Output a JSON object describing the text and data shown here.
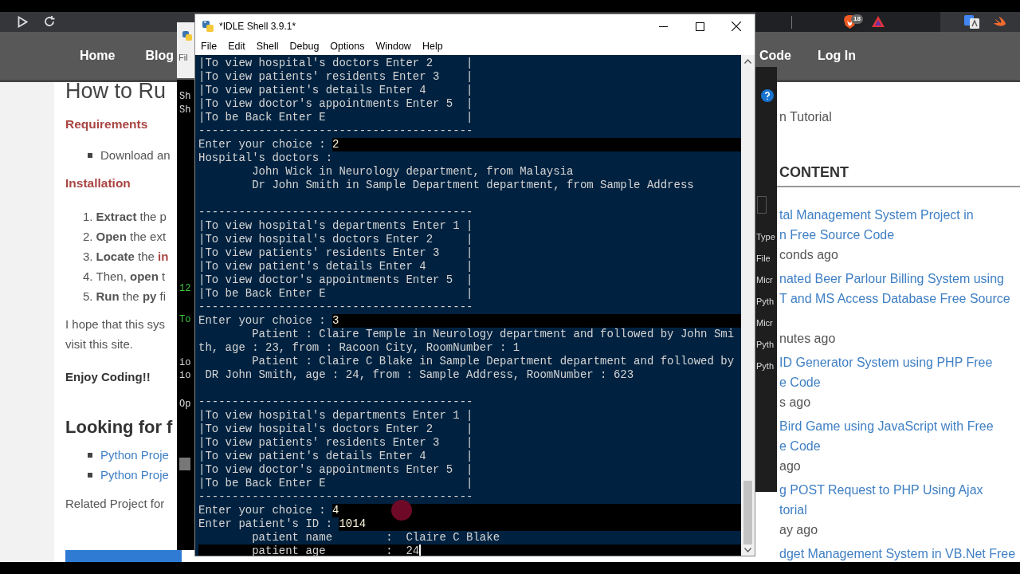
{
  "browser": {
    "extension_badge": "18",
    "nav_left": [
      "Home",
      "Blog"
    ],
    "nav_right": [
      "Code",
      "Log In"
    ]
  },
  "article": {
    "title": "How to Ru",
    "requirements_heading": "Requirements",
    "requirements": [
      "Download an"
    ],
    "installation_heading": "Installation",
    "steps": [
      {
        "number": "1.",
        "text": "**Extract** the p"
      },
      {
        "number": "2.",
        "text": "**Open** the ext"
      },
      {
        "number": "3.",
        "text": "**Locate** the ",
        "accent": "in"
      },
      {
        "number": "4.",
        "text": "Then, **open** t"
      },
      {
        "number": "5.",
        "text": "**Run** the **py** fi"
      }
    ],
    "paragraph": [
      "I hope that this sys",
      "visit this site."
    ],
    "closing": "Enjoy Coding!!",
    "more_heading": "Looking for f",
    "links": [
      "Python Proje",
      "Python Proje"
    ],
    "related": "Related Project for"
  },
  "sidebar": {
    "intro": "n Tutorial",
    "heading": "CONTENT",
    "posts": [
      {
        "title": [
          "tal Management System Project in",
          "n Free Source Code"
        ],
        "time": "conds ago"
      },
      {
        "title": [
          "nated Beer Parlour Billing System using",
          "T and MS Access Database Free Source"
        ],
        "covered_line": true,
        "time": "nutes ago"
      },
      {
        "title": [
          "ID Generator System using PHP Free",
          "e Code"
        ],
        "time": "s ago"
      },
      {
        "title": [
          "Bird Game using JavaScript with Free",
          "e Code"
        ],
        "time": "ago"
      },
      {
        "title": [
          "g POST Request to PHP Using Ajax",
          "torial"
        ],
        "time": "ay ago"
      },
      {
        "title": [
          "dget Management System in VB.Net Free"
        ]
      }
    ]
  },
  "back_window": {
    "left_lines": [
      {
        "text": "Sh",
        "kind": "plain"
      },
      {
        "text": "Sh",
        "kind": "plain"
      },
      {
        "text": "12",
        "kind": "green"
      },
      {
        "text": "To",
        "kind": "green"
      },
      {
        "text": "io",
        "kind": "plain"
      },
      {
        "text": "io",
        "kind": "plain"
      },
      {
        "text": "Op",
        "kind": "plain"
      }
    ],
    "right_items": [
      "Type",
      "File",
      "Micr",
      "Pyth",
      "Micr",
      "Pyth",
      "Pyth"
    ]
  },
  "other_idle": {
    "menu_fragment": "Fil"
  },
  "idle": {
    "title": "*IDLE Shell 3.9.1*",
    "menu": [
      "File",
      "Edit",
      "Shell",
      "Debug",
      "Options",
      "Window",
      "Help"
    ],
    "lines": [
      {
        "kind": "text",
        "text": "|To view hospital's doctors Enter 2     |"
      },
      {
        "kind": "text",
        "text": "|To view patients' residents Enter 3    |"
      },
      {
        "kind": "text",
        "text": "|To view patient's details Enter 4      |"
      },
      {
        "kind": "text",
        "text": "|To view doctor's appointments Enter 5  |"
      },
      {
        "kind": "text",
        "text": "|To be Back Enter E                     |"
      },
      {
        "kind": "text",
        "text": "-----------------------------------------"
      },
      {
        "kind": "input",
        "text": "Enter your choice : ",
        "input": "2"
      },
      {
        "kind": "text",
        "text": "Hospital's doctors :"
      },
      {
        "kind": "text",
        "text": "        John Wick in Neurology department, from Malaysia"
      },
      {
        "kind": "text",
        "text": "        Dr John Smith in Sample Department department, from Sample Address"
      },
      {
        "kind": "blank"
      },
      {
        "kind": "text",
        "text": "-----------------------------------------"
      },
      {
        "kind": "text",
        "text": "|To view hospital's departments Enter 1 |"
      },
      {
        "kind": "text",
        "text": "|To view hospital's doctors Enter 2     |"
      },
      {
        "kind": "text",
        "text": "|To view patients' residents Enter 3    |"
      },
      {
        "kind": "text",
        "text": "|To view patient's details Enter 4      |"
      },
      {
        "kind": "text",
        "text": "|To view doctor's appointments Enter 5  |"
      },
      {
        "kind": "text",
        "text": "|To be Back Enter E                     |"
      },
      {
        "kind": "text",
        "text": "-----------------------------------------"
      },
      {
        "kind": "input",
        "text": "Enter your choice : ",
        "input": "3"
      },
      {
        "kind": "text",
        "text": "        Patient : Claire Temple in Neurology department and followed by John Smi"
      },
      {
        "kind": "text",
        "text": "th, age : 23, from : Racoon City, RoomNumber : 1"
      },
      {
        "kind": "text",
        "text": "        Patient : Claire C Blake in Sample Department department and followed by"
      },
      {
        "kind": "text",
        "text": " DR John Smith, age : 24, from : Sample Address, RoomNumber : 623"
      },
      {
        "kind": "blank"
      },
      {
        "kind": "text",
        "text": "-----------------------------------------"
      },
      {
        "kind": "text",
        "text": "|To view hospital's departments Enter 1 |"
      },
      {
        "kind": "text",
        "text": "|To view hospital's doctors Enter 2     |"
      },
      {
        "kind": "text",
        "text": "|To view patients' residents Enter 3    |"
      },
      {
        "kind": "text",
        "text": "|To view patient's details Enter 4      |"
      },
      {
        "kind": "text",
        "text": "|To view doctor's appointments Enter 5  |"
      },
      {
        "kind": "text",
        "text": "|To be Back Enter E                     |"
      },
      {
        "kind": "text",
        "text": "-----------------------------------------"
      },
      {
        "kind": "input",
        "text": "Enter your choice : ",
        "input": "4"
      },
      {
        "kind": "input",
        "text": "Enter patient's ID : ",
        "input": "1014"
      },
      {
        "kind": "text",
        "text": "        patient name        :  Claire C Blake"
      },
      {
        "kind": "active",
        "text": "        patient age         :  24"
      }
    ]
  }
}
